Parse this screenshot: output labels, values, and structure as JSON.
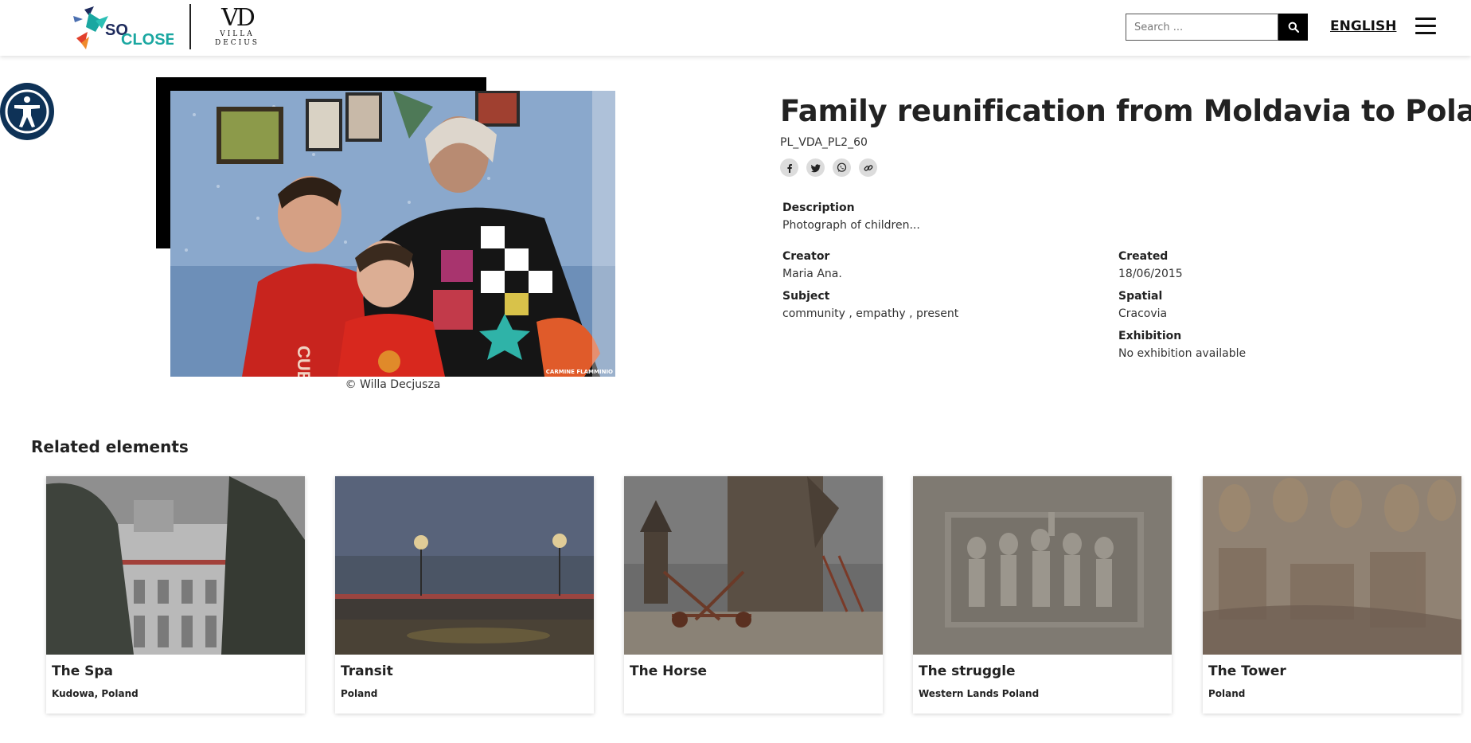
{
  "header": {
    "logo_text_so": "SO",
    "logo_text_close": "CLOSE",
    "logo_vd_mono": "VD",
    "logo_vd_line1": "VILLA",
    "logo_vd_line2": "DECIUS",
    "search_placeholder": "Search ...",
    "language": "ENGLISH"
  },
  "item": {
    "title": "Family reunification from Moldavia to Poland",
    "code": "PL_VDA_PL2_60",
    "photo_credit": "© Willa Decjusza",
    "photo_watermark": "CARMINE FLAMMINIO",
    "share_icons": [
      "facebook-icon",
      "twitter-icon",
      "whatsapp-icon",
      "link-icon"
    ],
    "description_label": "Description",
    "description": "Photograph of children...",
    "creator_label": "Creator",
    "creator": "Maria Ana.",
    "created_label": "Created",
    "created": "18/06/2015",
    "subject_label": "Subject",
    "subject": "community , empathy , present",
    "spatial_label": "Spatial",
    "spatial": "Cracovia",
    "exhibition_label": "Exhibition",
    "exhibition": "No exhibition available"
  },
  "related": {
    "heading": "Related elements",
    "cards": [
      {
        "title": "The Spa",
        "subtitle": "Kudowa, Poland"
      },
      {
        "title": "Transit",
        "subtitle": "Poland"
      },
      {
        "title": "The Horse",
        "subtitle": ""
      },
      {
        "title": "The struggle",
        "subtitle": "Western Lands Poland"
      },
      {
        "title": "The Tower",
        "subtitle": "Poland"
      }
    ]
  },
  "colors": {
    "accessibility_bg": "#0e3257",
    "logo_teal": "#1aa7a1",
    "logo_navy": "#1d2a5c",
    "logo_red": "#e2402c"
  }
}
